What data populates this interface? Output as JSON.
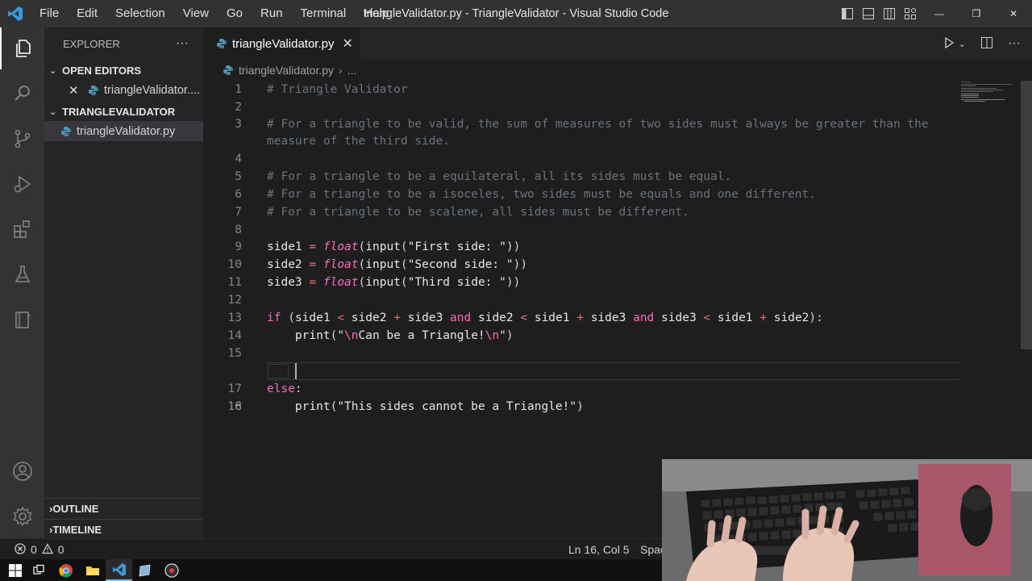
{
  "window": {
    "title": "triangleValidator.py - TriangleValidator - Visual Studio Code",
    "menu": [
      "File",
      "Edit",
      "Selection",
      "View",
      "Go",
      "Run",
      "Terminal",
      "Help"
    ]
  },
  "sidebar": {
    "header": "EXPLORER",
    "more": "···",
    "open_editors_label": "OPEN EDITORS",
    "open_editor_file": "triangleValidator....",
    "project_label": "TRIANGLEVALIDATOR",
    "project_file": "triangleValidator.py",
    "outline_label": "OUTLINE",
    "timeline_label": "TIMELINE"
  },
  "tab": {
    "label": "triangleValidator.py"
  },
  "breadcrumb": {
    "file": "triangleValidator.py",
    "more": "..."
  },
  "editor": {
    "current_line": 16,
    "line_numbers": [
      "1",
      "2",
      "3",
      "",
      "4",
      "5",
      "6",
      "7",
      "8",
      "9",
      "10",
      "11",
      "12",
      "13",
      "14",
      "15",
      "16",
      "17",
      "18"
    ],
    "comments": {
      "l1": "# Triangle Validator",
      "l3a": "# For a triangle to be valid, the sum of measures of two sides must always be greater than the",
      "l3b": "measure of the third side.",
      "l5": "# For a triangle to be a equilateral, all its sides must be equal.",
      "l6": "# For a triangle to be a isoceles, two sides must be equals and one different.",
      "l7": "# For a triangle to be scalene, all sides must be different."
    },
    "code": {
      "side1": "side1",
      "side2": "side2",
      "side3": "side3",
      "eq": "=",
      "float": "float",
      "input": "input",
      "str1": "\"First side: \"",
      "str2": "\"Second side: \"",
      "str3": "\"Third side: \"",
      "if": "if",
      "and": "and",
      "lt": "<",
      "plus": "+",
      "print": "print",
      "str14a": "\"",
      "esc": "\\n",
      "str14b": "Can be a Triangle!",
      "str14c": "\"",
      "else": "else",
      "str18": "\"This sides cannot be a Triangle!\""
    }
  },
  "statusbar": {
    "errors": "0",
    "warnings": "0",
    "position": "Ln 16, Col 5",
    "spaces": "Spac"
  }
}
